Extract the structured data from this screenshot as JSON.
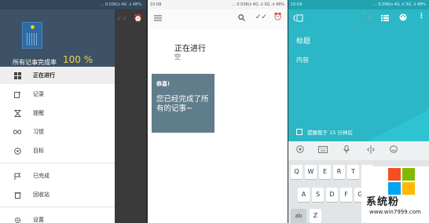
{
  "drawer_screen": {
    "status_right": "... 0.03K/s 4G .ıl 48%",
    "header": {
      "completion_label": "所有记事完成率",
      "completion_percent": "100 %"
    },
    "menu": [
      {
        "label": "正在进行",
        "icon": "grid-icon",
        "active": true
      },
      {
        "label": "记录",
        "icon": "note-icon",
        "active": false
      },
      {
        "label": "提醒",
        "icon": "hourglass-icon",
        "active": false
      },
      {
        "label": "习惯",
        "icon": "infinity-icon",
        "active": false
      },
      {
        "label": "目标",
        "icon": "target-icon",
        "active": false
      },
      {
        "label": "已完成",
        "icon": "flag-icon",
        "active": false
      },
      {
        "label": "回收站",
        "icon": "trash-icon",
        "active": false
      },
      {
        "label": "设置",
        "icon": "gear-icon",
        "active": false
      }
    ]
  },
  "list_screen": {
    "status_time": "10:08",
    "status_right": "... 0.03K/s 4G .ıl 3G .ıl 48%",
    "title": "正在进行",
    "empty": "空",
    "note": {
      "title": "恭喜!",
      "body": "您已经完成了所有的记事~"
    }
  },
  "edit_screen": {
    "status_time": "10:09",
    "status_right": "... 0.00K/s 4G .ıl 3G .ıl 48%",
    "title_placeholder": "标题",
    "content_placeholder": "内容",
    "reminder": "提醒我于 15 分钟后",
    "keyboard": {
      "row1": [
        "Q",
        "W",
        "E",
        "R",
        "T",
        "Y"
      ],
      "row2": [
        "A",
        "S",
        "D",
        "F",
        "G"
      ],
      "row3": [
        "ab",
        "Z"
      ]
    }
  },
  "watermark": {
    "title": "系统粉",
    "url": "www.win7999.com"
  },
  "colors": {
    "drawer_header": "#3d5266",
    "note_bg": "#607d8b",
    "teal": "#2bb7c5",
    "accent": "#f1d24a"
  }
}
